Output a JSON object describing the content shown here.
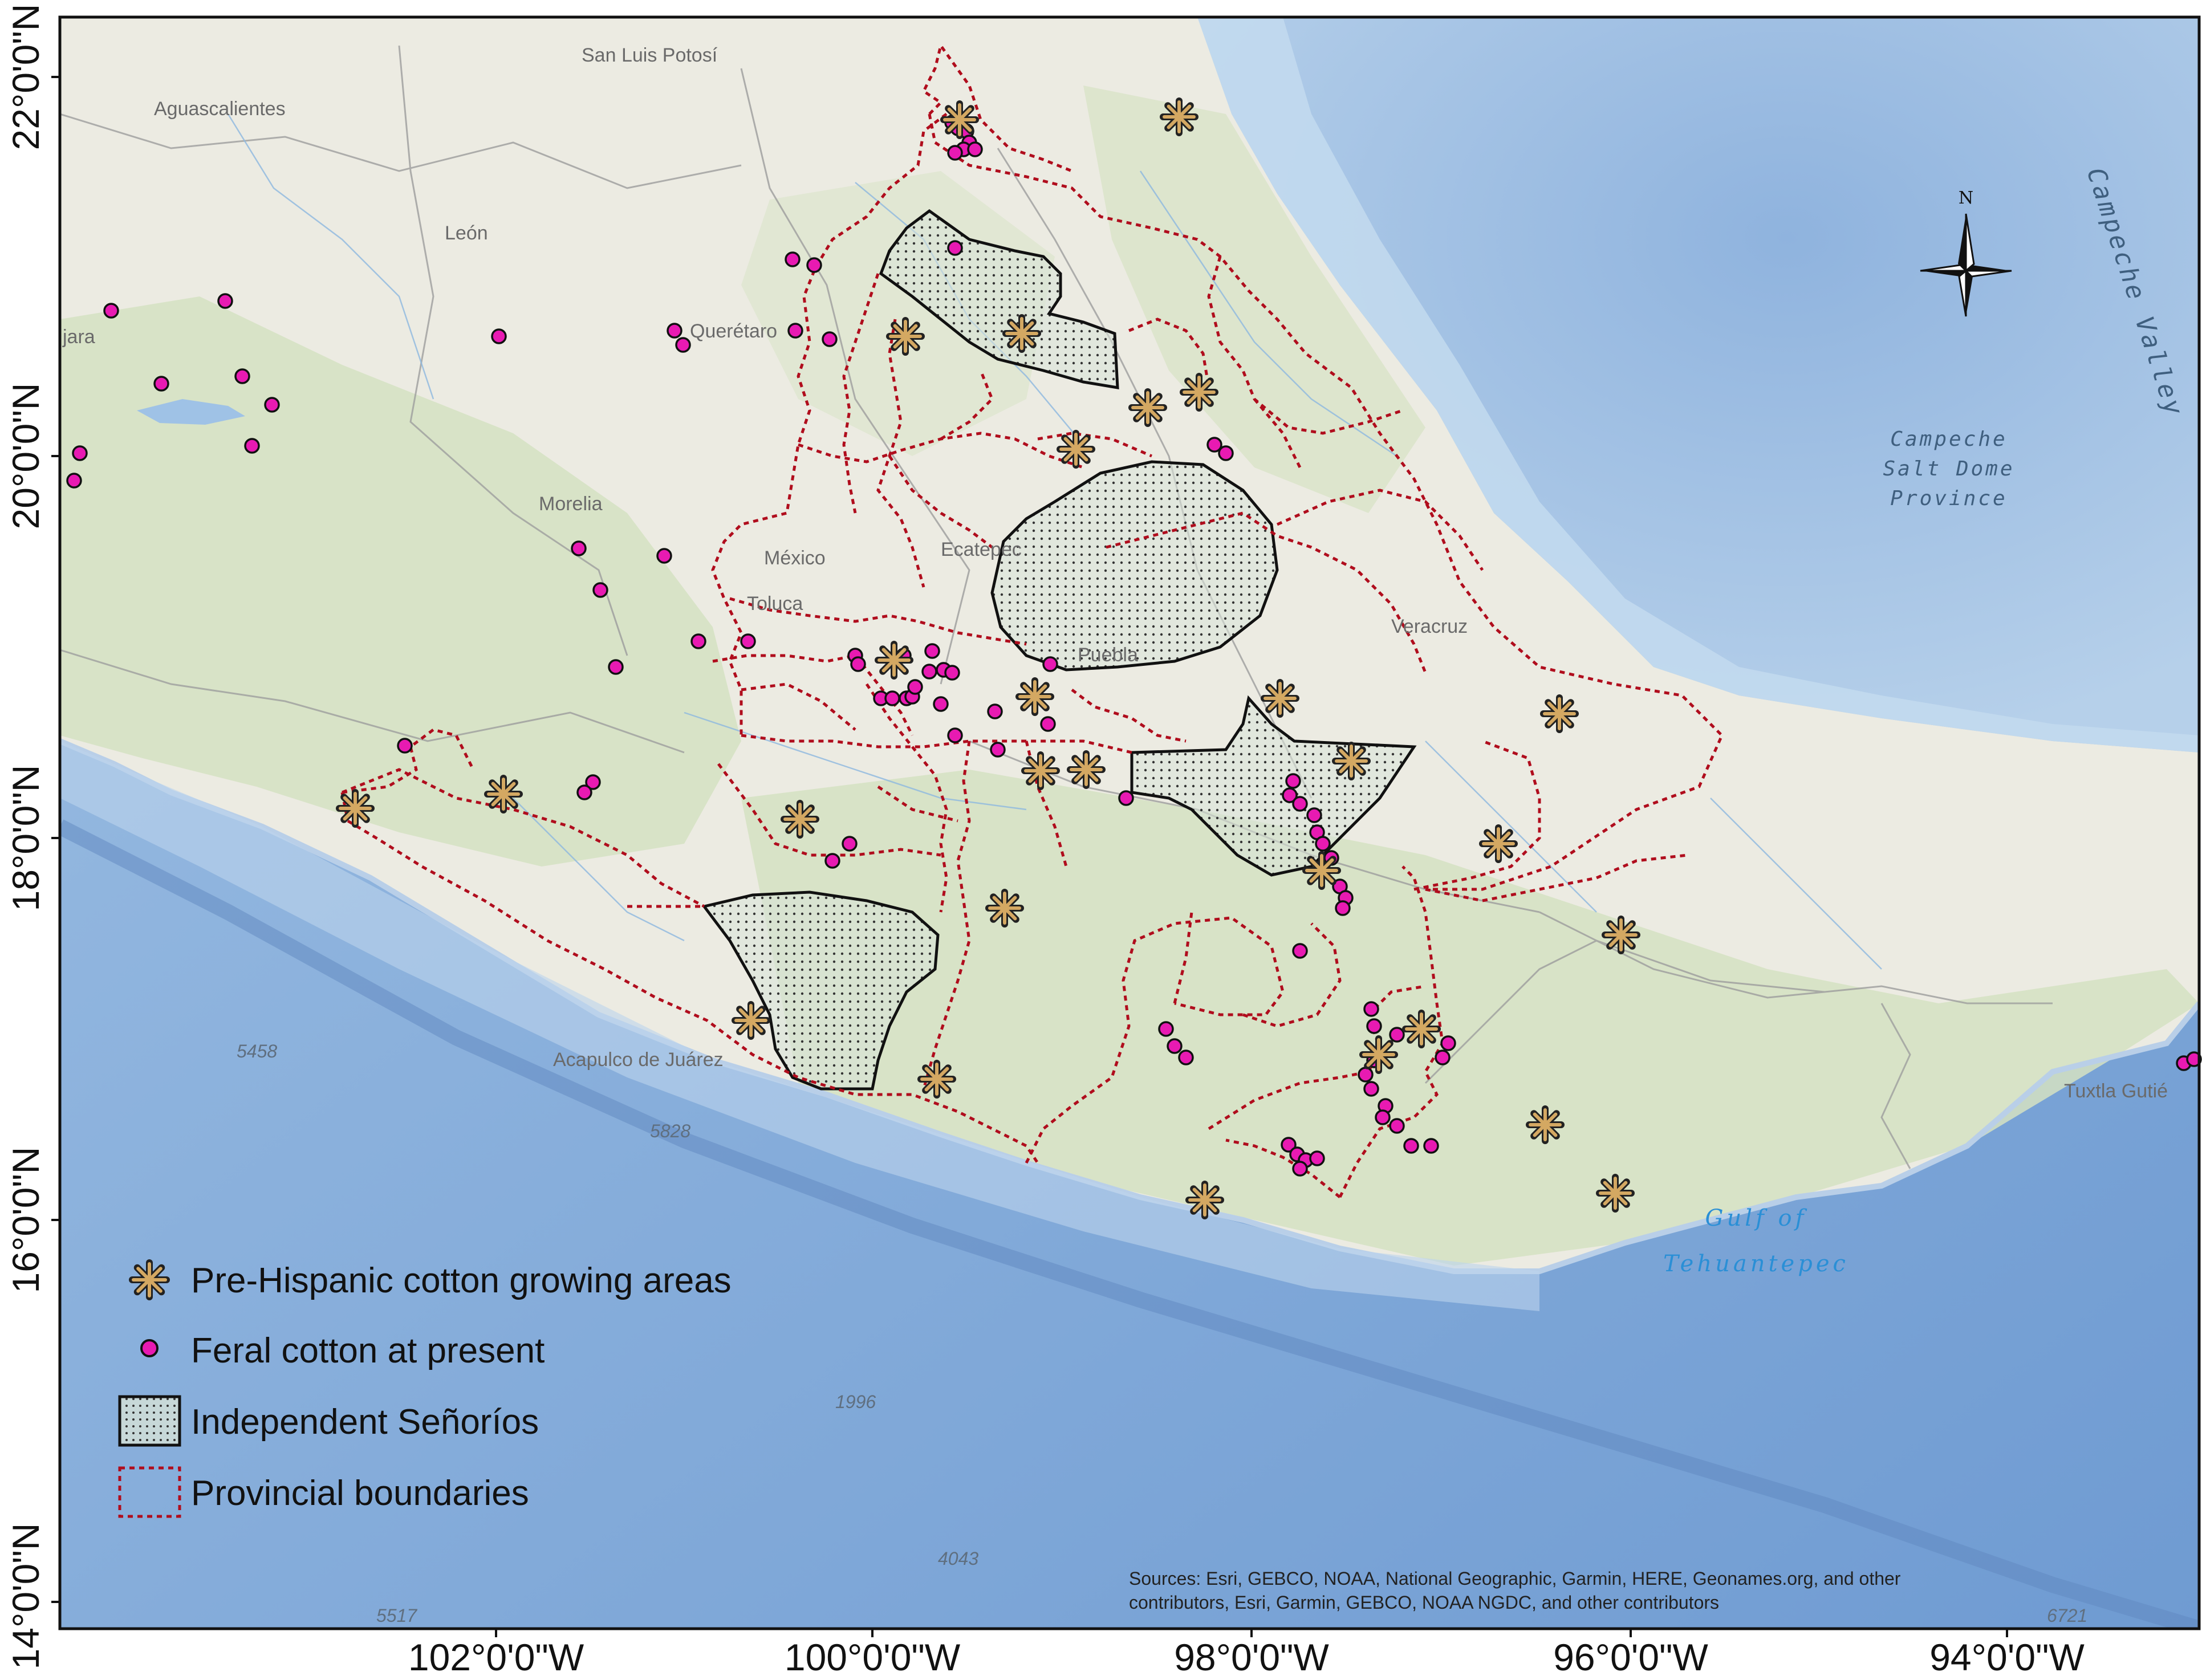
{
  "axes": {
    "latitude_labels": [
      "22°0'0\"N",
      "20°0'0\"N",
      "18°0'0\"N",
      "16°0'0\"N",
      "14°0'0\"N"
    ],
    "longitude_labels": [
      "102°0'0\"W",
      "100°0'0\"W",
      "98°0'0\"W",
      "96°0'0\"W",
      "94°0'0\"W"
    ]
  },
  "legend": {
    "cotton_growing": "Pre-Hispanic cotton growing areas",
    "feral_cotton": "Feral cotton at present",
    "senorios": "Independent Señoríos",
    "provincial": "Provincial boundaries"
  },
  "places": {
    "san_luis_potosi": "San Luis Potosí",
    "aguascalientes": "Aguascalientes",
    "leon": "León",
    "queretaro": "Querétaro",
    "morelia": "Morelia",
    "mexico": "México",
    "ecatepec": "Ecatepec",
    "toluca": "Toluca",
    "puebla": "Puebla",
    "veracruz": "Veracruz",
    "acapulco": "Acapulco de Juárez",
    "tuxtla": "Tuxtla Gutié",
    "guadalajara_fragment": "jara"
  },
  "water_labels": {
    "campeche_valley": "Campeche Valley",
    "salt_dome": [
      "Campeche",
      "Salt Dome",
      "Province"
    ],
    "gulf": [
      "Gulf of",
      "Tehuantepec"
    ]
  },
  "depths": [
    "5458",
    "5828",
    "1996",
    "4043",
    "6721",
    "5517"
  ],
  "north_arrow": "N",
  "sources": [
    "Sources: Esri, GEBCO, NOAA, National Geographic, Garmin, HERE, Geonames.org, and other",
    "contributors, Esri, Garmin, GEBCO, NOAA NGDC, and other contributors"
  ],
  "colors": {
    "land": "#ecebe2",
    "ocean": "#a9c6e6",
    "deep_ocean": "#7fa7d6",
    "gulf_shallow": "#b9d3ea",
    "vegetation": "#d7e3c4",
    "provincial_boundary": "#b00d1d",
    "senorio_outline": "#111111",
    "cotton_marker": "#d4a862",
    "feral_marker": "#e81ab2"
  }
}
